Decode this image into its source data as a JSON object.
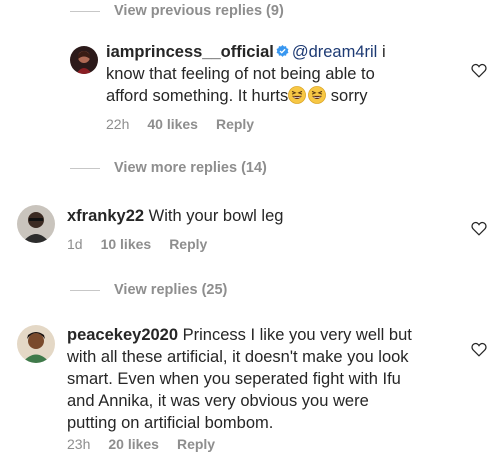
{
  "threads": {
    "view_previous_replies": "View previous replies (9)",
    "view_more_replies": "View more replies (14)",
    "view_replies": "View replies (25)"
  },
  "reply_1": {
    "username": "iamprincess__official",
    "mention": "@dream4ril",
    "text_line1": " i",
    "text_line2": "know that feeling of not being able to",
    "text_line3": "afford something. It hurts",
    "text_line3_tail": " sorry",
    "time": "22h",
    "likes": "40 likes",
    "reply": "Reply"
  },
  "comment_1": {
    "username": "xfranky22",
    "text": " With your bowl leg",
    "time": "1d",
    "likes": "10 likes",
    "reply": "Reply"
  },
  "comment_2": {
    "username": "peacekey2020",
    "text_line1": " Princess I like you very well but",
    "text_line2": "with all these artificial, it doesn't make you look",
    "text_line3": "smart. Even when you seperated fight with Ifu",
    "text_line4": "and Annika, it was very obvious you were",
    "text_line5": "putting on artificial bombom.",
    "time": "23h",
    "likes": "20 likes",
    "reply": "Reply"
  },
  "icons": {
    "verified": "verified-badge-icon",
    "like": "heart-icon",
    "emoji": "grinning-squinting-face-emoji"
  },
  "colors": {
    "verified_blue": "#3897f0",
    "meta_gray": "#8e8e8e",
    "text": "#262626"
  }
}
